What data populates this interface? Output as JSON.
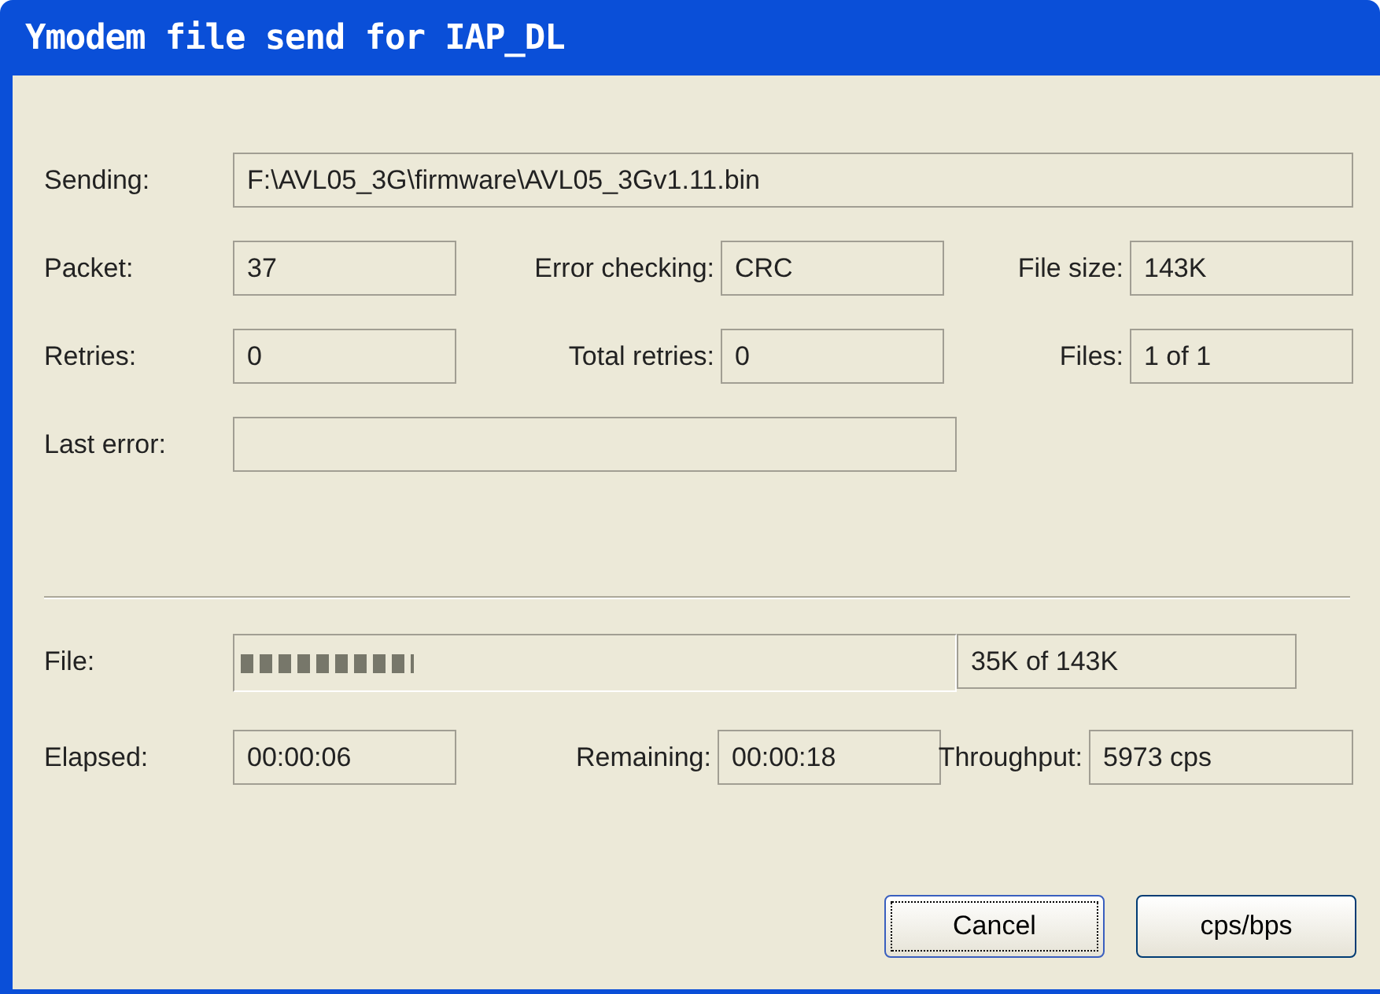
{
  "window": {
    "title": "Ymodem file send for IAP_DL"
  },
  "rows": [
    {
      "items": [
        {
          "kind": "label",
          "text": "Sending:"
        },
        {
          "kind": "field",
          "text": "F:\\AVL05_3G\\firmware\\AVL05_3Gv1.11.bin"
        }
      ]
    },
    {
      "items": [
        {
          "kind": "label",
          "text": "Packet:"
        },
        {
          "kind": "field",
          "text": "37"
        },
        {
          "kind": "label",
          "text": "Error checking:"
        },
        {
          "kind": "field",
          "text": "CRC"
        },
        {
          "kind": "label",
          "text": "File size:"
        },
        {
          "kind": "field",
          "text": "143K"
        }
      ]
    },
    {
      "items": [
        {
          "kind": "label",
          "text": "Retries:"
        },
        {
          "kind": "field",
          "text": "0"
        },
        {
          "kind": "label",
          "text": "Total retries:"
        },
        {
          "kind": "field",
          "text": "0"
        },
        {
          "kind": "label",
          "text": "Files:"
        },
        {
          "kind": "field",
          "text": "1 of 1"
        }
      ]
    },
    {
      "items": [
        {
          "kind": "label",
          "text": "Last error:"
        },
        {
          "kind": "field"
        }
      ]
    },
    {
      "items": [
        {
          "kind": "rule"
        }
      ]
    },
    {
      "items": [
        {
          "kind": "label",
          "text": "File:"
        },
        {
          "kind": "progress",
          "level": 0.245
        },
        {
          "kind": "field",
          "text": "35K of 143K"
        }
      ]
    },
    {
      "items": [
        {
          "kind": "label",
          "text": "Elapsed:"
        },
        {
          "kind": "field",
          "text": "00:00:06"
        },
        {
          "kind": "label",
          "text": "Remaining:"
        },
        {
          "kind": "field",
          "text": "00:00:18"
        },
        {
          "kind": "label",
          "text": "Throughput:"
        },
        {
          "kind": "field",
          "text": "5973 cps"
        }
      ]
    }
  ],
  "buttons": [
    {
      "label": "Cancel",
      "focused": true
    },
    {
      "label": "cps/bps",
      "focused": false
    }
  ]
}
